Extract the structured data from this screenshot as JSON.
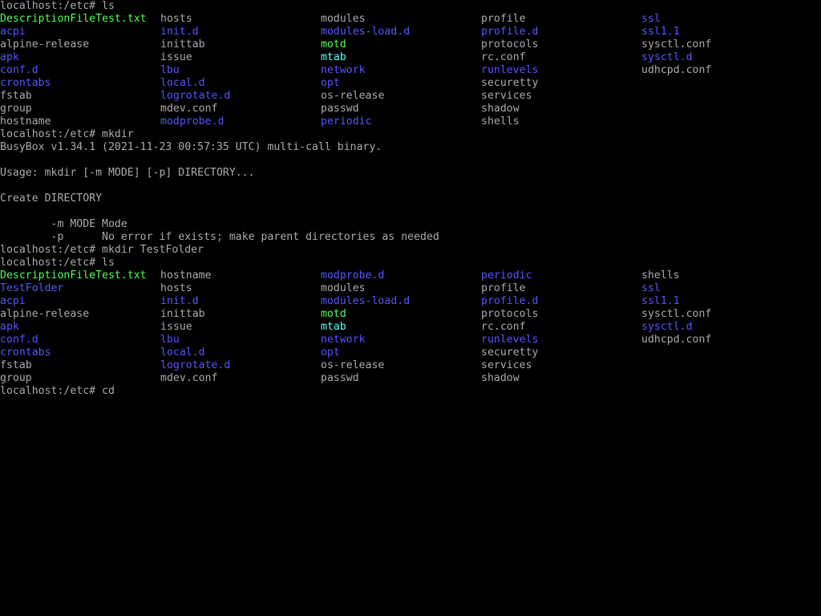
{
  "terminal": {
    "colors": {
      "background": "#000000",
      "foreground": "#aaaaaa",
      "directory": "#5555ff",
      "executable": "#55ff55",
      "symlink": "#55ffff"
    },
    "prompt": "localhost:/etc#",
    "commands": {
      "ls1": "localhost:/etc# ls",
      "mkdir": "localhost:/etc# mkdir",
      "mkdir_folder": "localhost:/etc# mkdir TestFolder",
      "ls2": "localhost:/etc# ls",
      "cd": "localhost:/etc# cd"
    },
    "listing1": [
      [
        {
          "name": "DescriptionFileTest.txt",
          "type": "exec"
        },
        {
          "name": "hosts",
          "type": "file"
        },
        {
          "name": "modules",
          "type": "file"
        },
        {
          "name": "profile",
          "type": "file"
        },
        {
          "name": "ssl",
          "type": "dir"
        }
      ],
      [
        {
          "name": "acpi",
          "type": "dir"
        },
        {
          "name": "init.d",
          "type": "dir"
        },
        {
          "name": "modules-load.d",
          "type": "dir"
        },
        {
          "name": "profile.d",
          "type": "dir"
        },
        {
          "name": "ssl1.1",
          "type": "dir"
        }
      ],
      [
        {
          "name": "alpine-release",
          "type": "file"
        },
        {
          "name": "inittab",
          "type": "file"
        },
        {
          "name": "motd",
          "type": "exec"
        },
        {
          "name": "protocols",
          "type": "file"
        },
        {
          "name": "sysctl.conf",
          "type": "file"
        }
      ],
      [
        {
          "name": "apk",
          "type": "dir"
        },
        {
          "name": "issue",
          "type": "file"
        },
        {
          "name": "mtab",
          "type": "link"
        },
        {
          "name": "rc.conf",
          "type": "file"
        },
        {
          "name": "sysctl.d",
          "type": "dir"
        }
      ],
      [
        {
          "name": "conf.d",
          "type": "dir"
        },
        {
          "name": "lbu",
          "type": "dir"
        },
        {
          "name": "network",
          "type": "dir"
        },
        {
          "name": "runlevels",
          "type": "dir"
        },
        {
          "name": "udhcpd.conf",
          "type": "file"
        }
      ],
      [
        {
          "name": "crontabs",
          "type": "dir"
        },
        {
          "name": "local.d",
          "type": "dir"
        },
        {
          "name": "opt",
          "type": "dir"
        },
        {
          "name": "securetty",
          "type": "file"
        },
        {
          "name": "",
          "type": "file"
        }
      ],
      [
        {
          "name": "fstab",
          "type": "file"
        },
        {
          "name": "logrotate.d",
          "type": "dir"
        },
        {
          "name": "os-release",
          "type": "file"
        },
        {
          "name": "services",
          "type": "file"
        },
        {
          "name": "",
          "type": "file"
        }
      ],
      [
        {
          "name": "group",
          "type": "file"
        },
        {
          "name": "mdev.conf",
          "type": "file"
        },
        {
          "name": "passwd",
          "type": "file"
        },
        {
          "name": "shadow",
          "type": "file"
        },
        {
          "name": "",
          "type": "file"
        }
      ],
      [
        {
          "name": "hostname",
          "type": "file"
        },
        {
          "name": "modprobe.d",
          "type": "dir"
        },
        {
          "name": "periodic",
          "type": "dir"
        },
        {
          "name": "shells",
          "type": "file"
        },
        {
          "name": "",
          "type": "file"
        }
      ]
    ],
    "mkdir_output": [
      "BusyBox v1.34.1 (2021-11-23 00:57:35 UTC) multi-call binary.",
      "",
      "Usage: mkdir [-m MODE] [-p] DIRECTORY...",
      "",
      "Create DIRECTORY",
      "",
      "        -m MODE Mode",
      "        -p      No error if exists; make parent directories as needed"
    ],
    "listing2": [
      [
        {
          "name": "DescriptionFileTest.txt",
          "type": "exec"
        },
        {
          "name": "hostname",
          "type": "file"
        },
        {
          "name": "modprobe.d",
          "type": "dir"
        },
        {
          "name": "periodic",
          "type": "dir"
        },
        {
          "name": "shells",
          "type": "file"
        }
      ],
      [
        {
          "name": "TestFolder",
          "type": "dir"
        },
        {
          "name": "hosts",
          "type": "file"
        },
        {
          "name": "modules",
          "type": "file"
        },
        {
          "name": "profile",
          "type": "file"
        },
        {
          "name": "ssl",
          "type": "dir"
        }
      ],
      [
        {
          "name": "acpi",
          "type": "dir"
        },
        {
          "name": "init.d",
          "type": "dir"
        },
        {
          "name": "modules-load.d",
          "type": "dir"
        },
        {
          "name": "profile.d",
          "type": "dir"
        },
        {
          "name": "ssl1.1",
          "type": "dir"
        }
      ],
      [
        {
          "name": "alpine-release",
          "type": "file"
        },
        {
          "name": "inittab",
          "type": "file"
        },
        {
          "name": "motd",
          "type": "exec"
        },
        {
          "name": "protocols",
          "type": "file"
        },
        {
          "name": "sysctl.conf",
          "type": "file"
        }
      ],
      [
        {
          "name": "apk",
          "type": "dir"
        },
        {
          "name": "issue",
          "type": "file"
        },
        {
          "name": "mtab",
          "type": "link"
        },
        {
          "name": "rc.conf",
          "type": "file"
        },
        {
          "name": "sysctl.d",
          "type": "dir"
        }
      ],
      [
        {
          "name": "conf.d",
          "type": "dir"
        },
        {
          "name": "lbu",
          "type": "dir"
        },
        {
          "name": "network",
          "type": "dir"
        },
        {
          "name": "runlevels",
          "type": "dir"
        },
        {
          "name": "udhcpd.conf",
          "type": "file"
        }
      ],
      [
        {
          "name": "crontabs",
          "type": "dir"
        },
        {
          "name": "local.d",
          "type": "dir"
        },
        {
          "name": "opt",
          "type": "dir"
        },
        {
          "name": "securetty",
          "type": "file"
        },
        {
          "name": "",
          "type": "file"
        }
      ],
      [
        {
          "name": "fstab",
          "type": "file"
        },
        {
          "name": "logrotate.d",
          "type": "dir"
        },
        {
          "name": "os-release",
          "type": "file"
        },
        {
          "name": "services",
          "type": "file"
        },
        {
          "name": "",
          "type": "file"
        }
      ],
      [
        {
          "name": "group",
          "type": "file"
        },
        {
          "name": "mdev.conf",
          "type": "file"
        },
        {
          "name": "passwd",
          "type": "file"
        },
        {
          "name": "shadow",
          "type": "file"
        },
        {
          "name": "",
          "type": "file"
        }
      ]
    ]
  }
}
